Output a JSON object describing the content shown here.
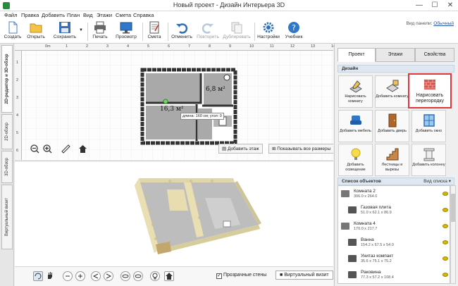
{
  "window": {
    "title": "Новый проект - Дизайн Интерьера 3D",
    "minimize": "—",
    "maximize": "☐",
    "close": "✕"
  },
  "menu": [
    "Файл",
    "Правка",
    "Добавить",
    "План",
    "Вид",
    "Этажи",
    "Смета",
    "Справка"
  ],
  "toolbar": {
    "create": "Создать",
    "open": "Открыть",
    "save": "Сохранить",
    "print": "Печать",
    "preview": "Просмотр",
    "estimate": "Смета",
    "undo": "Отменить",
    "redo": "Повторить",
    "duplicate": "Дублировать",
    "settings": "Настройки",
    "tutorial": "Учебник",
    "panel_view_label": "Вид панели:",
    "panel_view_value": "Обычный"
  },
  "left_tabs": {
    "editor": "2D-редактор и 3D-обзор",
    "view2d": "2D-обзор",
    "view3d": "3D-обзор",
    "virtual": "Виртуальный визит"
  },
  "ruler": {
    "top": [
      "0m",
      "1",
      "2",
      "3",
      "4",
      "5",
      "6",
      "7",
      "8",
      "9",
      "10",
      "11",
      "12",
      "13",
      "14"
    ],
    "left": [
      "1",
      "2",
      "3",
      "4",
      "5",
      "6"
    ]
  },
  "plan": {
    "room_large_area": "16,3 м²",
    "room_small_area": "6,8 м²",
    "tooltip": "длина: 160 см; угол: 0",
    "add_floor": "Добавить этаж",
    "show_all_dims": "Показывать все размеры"
  },
  "bottom": {
    "transparent_walls": "Прозрачные стены",
    "virtual_visit": "Виртуальный визит"
  },
  "right_tabs": [
    "Проект",
    "Этажи",
    "Свойства"
  ],
  "design": {
    "header": "Дизайн",
    "buttons": [
      "Нарисовать комнату",
      "Добавить комнату",
      "Нарисовать перегородку",
      "Добавить мебель",
      "Добавить дверь",
      "Добавить окно",
      "Добавить освещение",
      "Лестницы и вырезы",
      "Добавить колонну"
    ]
  },
  "objects": {
    "header": "Список объектов",
    "view_label": "Вид списка",
    "items": [
      {
        "name": "Комната 2",
        "dims": "306.0 x 264.0",
        "child": false
      },
      {
        "name": "Газовая плита",
        "dims": "51.0 x 62.1 x 86.9",
        "child": true
      },
      {
        "name": "Комната 4",
        "dims": "170.0 x 217.7",
        "child": false
      },
      {
        "name": "Ванна",
        "dims": "154.2 x 67.5 x 54.0",
        "child": true
      },
      {
        "name": "Унитаз компакт",
        "dims": "35.6 x 75.1 x 75.2",
        "child": true
      },
      {
        "name": "Раковина",
        "dims": "77.3 x 57.2 x 108.4",
        "child": true
      }
    ]
  },
  "colors": {
    "accent": "#e0353a",
    "wall": "#3a3a3a",
    "floor": "#a9a9a9",
    "wallpaper": "#e9dfb2"
  }
}
